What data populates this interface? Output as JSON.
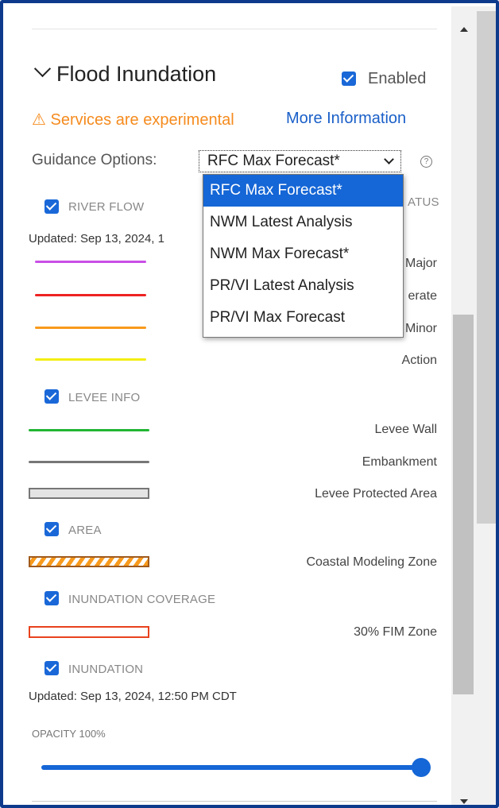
{
  "section": {
    "title": "Flood Inundation",
    "enabled_label": "Enabled",
    "enabled": true
  },
  "notice": {
    "warning": "⚠ Services are experimental",
    "link": "More Information"
  },
  "guidance": {
    "label": "Guidance Options:",
    "selected": "RFC Max Forecast*",
    "options": [
      "RFC Max Forecast*",
      "NWM Latest Analysis",
      "NWM Max Forecast*",
      "PR/VI Latest Analysis",
      "PR/VI Max Forecast"
    ]
  },
  "river_flow": {
    "label": "RIVER FLOW",
    "status_fragment": "ATUS",
    "updated": "Updated: Sep 13, 2024, 1",
    "legend": [
      "Major",
      "erate",
      "Minor",
      "Action"
    ]
  },
  "levee_info": {
    "label": "LEVEE INFO",
    "legend": [
      "Levee Wall",
      "Embankment",
      "Levee Protected Area"
    ]
  },
  "area": {
    "label": "AREA",
    "legend": [
      "Coastal Modeling Zone"
    ]
  },
  "inundation_coverage": {
    "label": "INUNDATION COVERAGE",
    "legend": [
      "30% FIM Zone"
    ]
  },
  "inundation": {
    "label": "INUNDATION",
    "updated": "Updated: Sep 13, 2024, 12:50 PM CDT"
  },
  "opacity": {
    "label": "OPACITY 100%",
    "value": 100
  },
  "colors": {
    "accent": "#1566d6",
    "warning": "#f58b1e",
    "major": "#c94fe6",
    "moderate": "#ee2222",
    "minor": "#f89a1c",
    "action": "#f3ee13",
    "levee_wall": "#22b533",
    "embankment": "#777777",
    "fim_zone": "#e8421e"
  }
}
